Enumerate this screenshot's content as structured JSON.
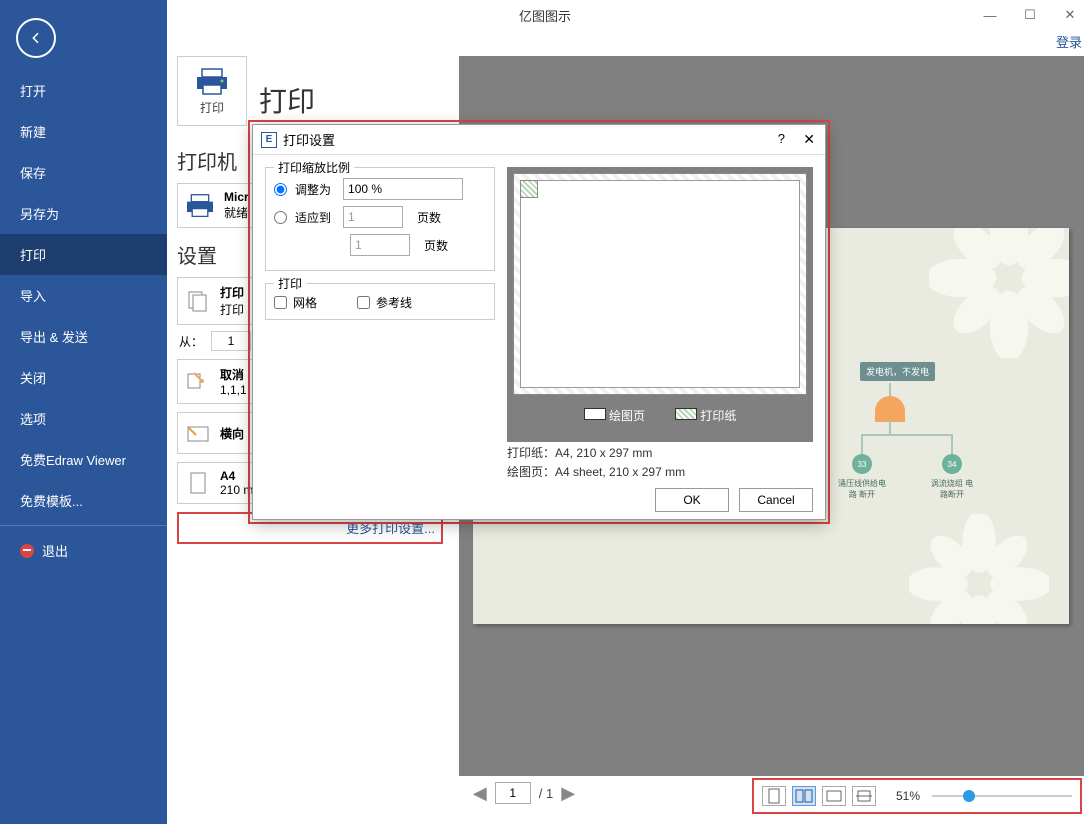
{
  "titlebar": {
    "title": "亿图图示"
  },
  "login": "登录",
  "sidebar": {
    "items": [
      "打开",
      "新建",
      "保存",
      "另存为",
      "打印",
      "导入",
      "导出 & 发送",
      "关闭",
      "选项",
      "免费Edraw Viewer",
      "免费模板..."
    ],
    "exit": "退出"
  },
  "main": {
    "heading": "打印",
    "print_btn": "打印",
    "printer_section": "打印机",
    "printer_name": "Micr",
    "printer_status": "就绪",
    "settings_section": "设置",
    "rows": {
      "print_pages": {
        "title": "打印",
        "sub": "打印"
      },
      "from_label": "从：",
      "from_value": "1",
      "cancel": {
        "title": "取消",
        "sub": "1,1,1"
      },
      "orientation": {
        "title": "横向"
      },
      "paper": {
        "title": "A4",
        "sub": "210 mm x 297 mm"
      }
    },
    "more_settings": "更多打印设置..."
  },
  "dialog": {
    "title": "打印设置",
    "scale_legend": "打印缩放比例",
    "adjust_to": "调整为",
    "adjust_value": "100 %",
    "fit_to": "适应到",
    "fit_w": "1",
    "fit_h": "1",
    "pages_label": "页数",
    "print_legend": "打印",
    "grid": "网格",
    "guides": "参考线",
    "legend_drawing": "绘图页",
    "legend_paper": "打印纸",
    "info_paper": "打印纸：A4, 210 x 297 mm",
    "info_page": "绘图页：A4 sheet, 210 x 297 mm",
    "ok": "OK",
    "cancel": "Cancel"
  },
  "pager": {
    "current": "1",
    "total": "/ 1"
  },
  "footer": {
    "zoom": "51%"
  },
  "diagram": {
    "top_node": "发电机，不发电",
    "circ1": "33",
    "circ2": "34",
    "label1": "涌压线供给电路\n断开",
    "label2": "涡流烧组\n电路断开"
  }
}
